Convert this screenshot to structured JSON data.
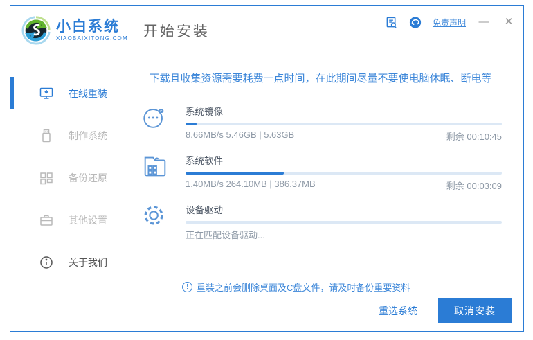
{
  "window": {
    "logo": {
      "name": "小白系统",
      "domain": "XIAOBAIXITONG.COM"
    },
    "page_title": "开始安装",
    "titlebar": {
      "disclaimer_label": "免责声明",
      "minimize_glyph": "—",
      "close_glyph": "✕"
    }
  },
  "sidebar": {
    "items": [
      {
        "label": "在线重装",
        "icon": "monitor-reinstall-icon",
        "active": true
      },
      {
        "label": "制作系统",
        "icon": "usb-drive-icon",
        "active": false
      },
      {
        "label": "备份还原",
        "icon": "backup-blocks-icon",
        "active": false
      },
      {
        "label": "其他设置",
        "icon": "briefcase-icon",
        "active": false
      },
      {
        "label": "关于我们",
        "icon": "info-circle-icon",
        "active": false
      }
    ]
  },
  "main": {
    "tip": "下载且收集资源需要耗费一点时间，在此期间尽量不要使电脑休眠、断电等",
    "tasks": [
      {
        "name": "系统镜像",
        "icon": "face-chat-icon",
        "progress_percent": 3.5,
        "stats": "8.66MB/s 5.46GB | 5.63GB",
        "remaining": "剩余 00:10:45"
      },
      {
        "name": "系统软件",
        "icon": "folder-apps-icon",
        "progress_percent": 31,
        "stats": "1.40MB/s 264.10MB | 386.37MB",
        "remaining": "剩余 00:03:09"
      },
      {
        "name": "设备驱动",
        "icon": "gear-icon",
        "progress_percent": 0,
        "status": "正在匹配设备驱动..."
      }
    ],
    "warning_icon_glyph": "!",
    "warning": "重装之前会删除桌面及C盘文件，请及时备份重要资料",
    "footer": {
      "reselect_label": "重选系统",
      "cancel_label": "取消安装"
    }
  },
  "colors": {
    "accent": "#2b7cd5",
    "progress_track": "#dce8f5",
    "progress_fill": "#2b7cd5",
    "tip_text": "#3d87d9",
    "inactive_text": "#b9b9b9"
  }
}
